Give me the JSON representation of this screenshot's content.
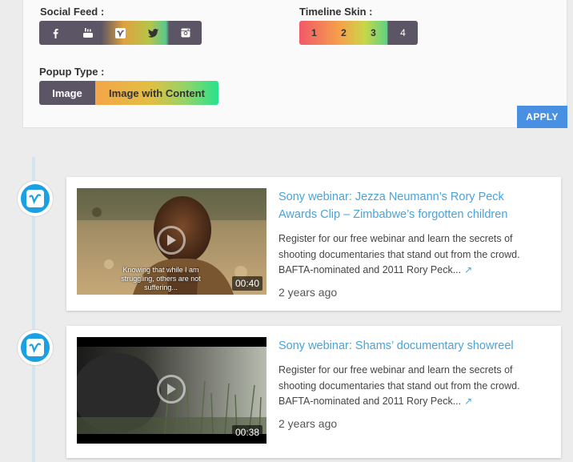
{
  "settings": {
    "social_feed_label": "Social Feed :",
    "social_icons": [
      "facebook-icon",
      "youtube-icon",
      "vimeo-icon",
      "twitter-icon",
      "instagram-icon"
    ],
    "timeline_skin_label": "Timeline Skin :",
    "skins": [
      "1",
      "2",
      "3",
      "4"
    ],
    "skin_active": "4",
    "popup_type_label": "Popup Type :",
    "popup_options": [
      "Image",
      "Image with Content"
    ],
    "popup_active": "Image",
    "apply_label": "APPLY"
  },
  "colors": {
    "accent": "#4a90e2",
    "link": "#4aa3d8",
    "vimeo": "#1ba1e2",
    "dark_segment": "#5b5566"
  },
  "feed": [
    {
      "source_icon": "vimeo-icon",
      "title": "Sony webinar: Jezza Neumann’s Rory Peck Awards Clip – Zimbabwe’s forgotten children",
      "description": "Register for our free webinar and learn the secrets of shooting documentaries that stand out from the crowd. BAFTA-nominated and 2011 Rory Peck...",
      "time": "2 years ago",
      "duration": "00:40",
      "thumb_subtitle": "Knowing that while I am struggling, others are not suffering..."
    },
    {
      "source_icon": "vimeo-icon",
      "title": "Sony webinar: Shams’ documentary showreel",
      "description": "Register for our free webinar and learn the secrets of shooting documentaries that stand out from the crowd. BAFTA-nominated and 2011 Rory Peck...",
      "time": "2 years ago",
      "duration": "00:38"
    }
  ]
}
